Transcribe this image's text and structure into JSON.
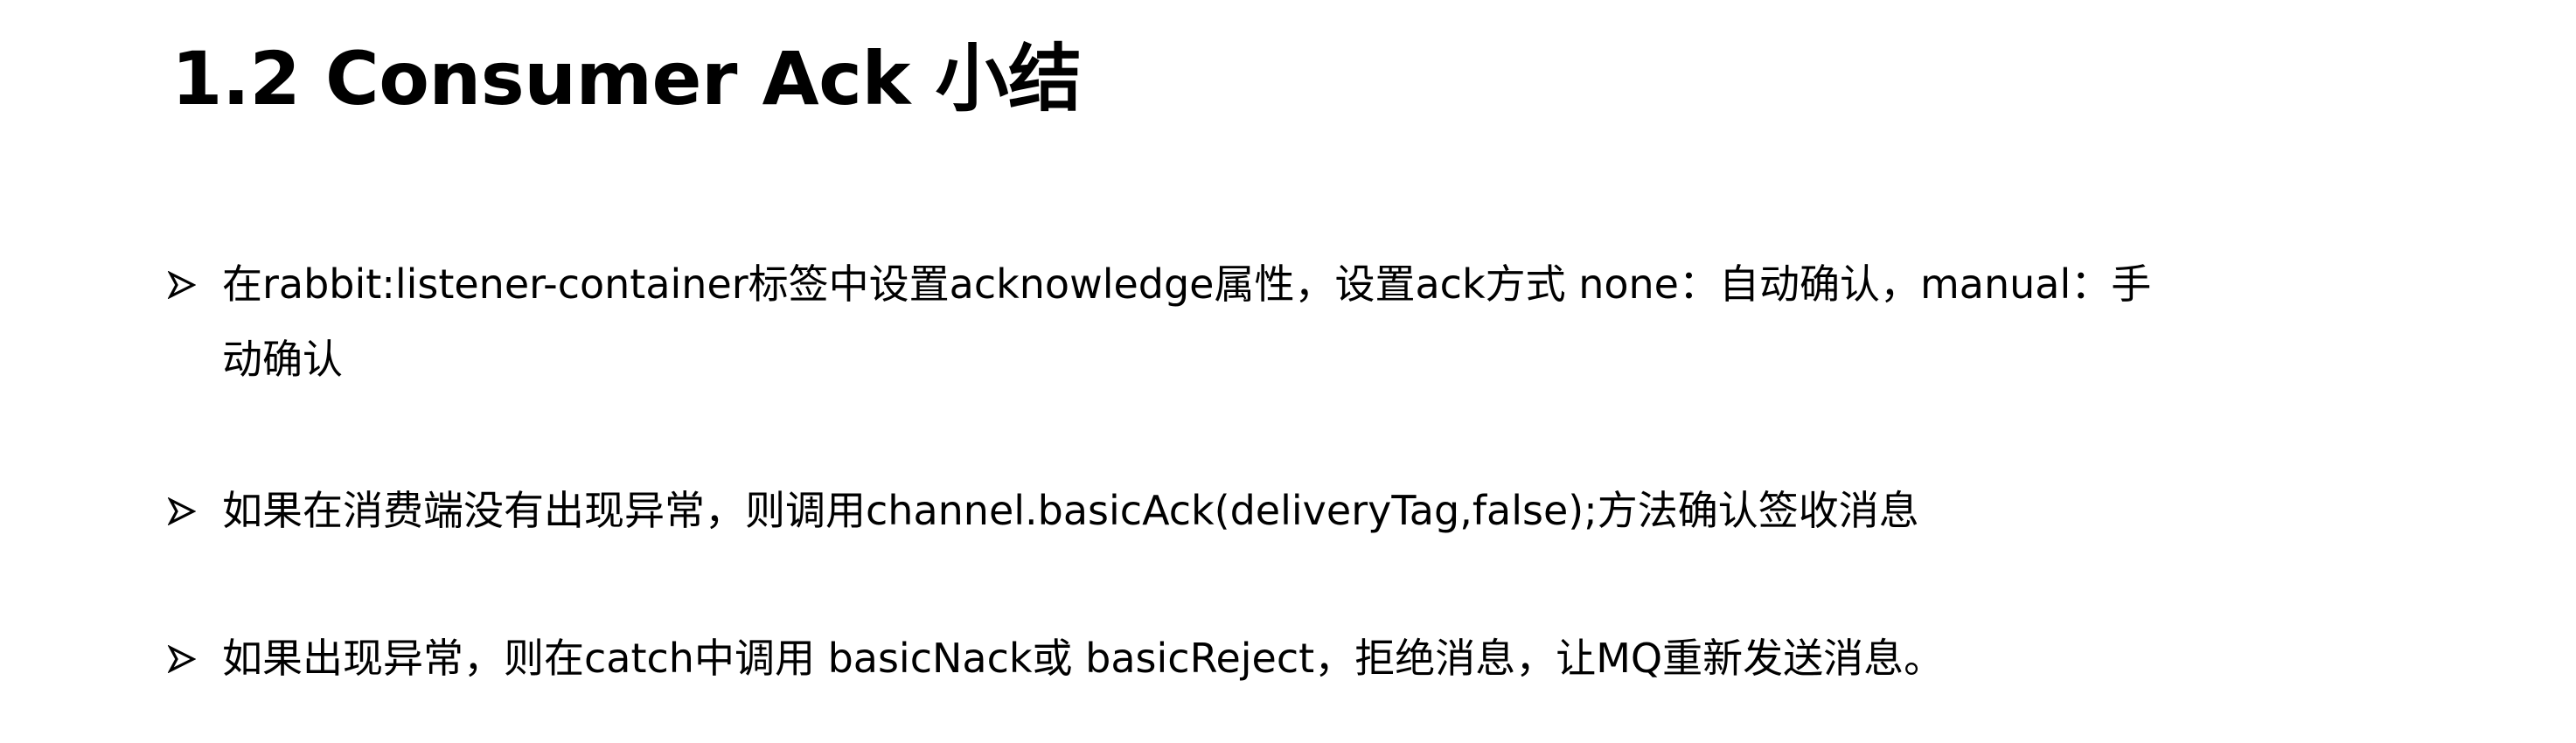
{
  "heading": {
    "title": "1.2 Consumer Ack 小结"
  },
  "icons": {
    "bullet_marker": "arrow-bullet-icon"
  },
  "bullets": [
    {
      "line1": "在rabbit:listener-container标签中设置acknowledge属性，设置ack方式 none：自动确认，manual：手",
      "line2": "动确认"
    },
    {
      "line1": "如果在消费端没有出现异常，则调用channel.basicAck(deliveryTag,false);方法确认签收消息"
    },
    {
      "line1": "如果出现异常，则在catch中调用 basicNack或 basicReject，拒绝消息，让MQ重新发送消息。"
    }
  ]
}
